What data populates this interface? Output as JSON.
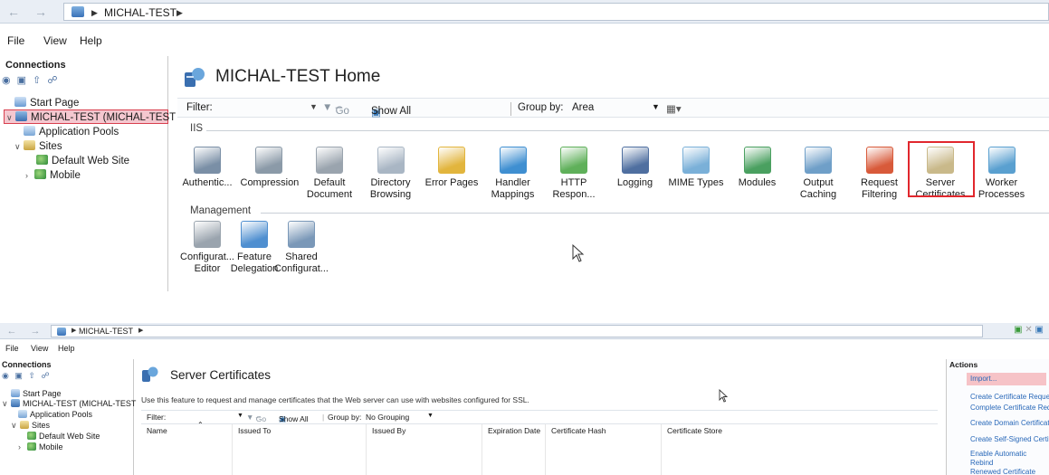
{
  "win1": {
    "address": {
      "crumb": "MICHAL-TEST"
    },
    "menu": [
      "File",
      "View",
      "Help"
    ],
    "connections": {
      "title": "Connections",
      "tree": [
        {
          "label": "Start Page",
          "icon": "start-page-icon"
        },
        {
          "label": "MICHAL-TEST (MICHAL-TEST",
          "icon": "server-icon",
          "selected": true
        },
        {
          "label": "Application Pools",
          "icon": "app-pools-icon"
        },
        {
          "label": "Sites",
          "icon": "sites-folder-icon"
        },
        {
          "label": "Default Web Site",
          "icon": "globe-icon"
        },
        {
          "label": "Mobile",
          "icon": "globe-icon"
        }
      ]
    },
    "home_title": "MICHAL-TEST Home",
    "filter": {
      "label": "Filter:",
      "go": "Go",
      "show_all": "Show All",
      "group_by": "Group by:",
      "group_value": "Area"
    },
    "iis_section": "IIS",
    "iis_features": [
      {
        "label": "Authentic...",
        "icon": "authentication-icon",
        "color": "#7a8fa6"
      },
      {
        "label": "Compression",
        "icon": "compression-icon",
        "color": "#8b9aa8"
      },
      {
        "label": "Default\nDocument",
        "icon": "default-document-icon",
        "color": "#9aa4ae"
      },
      {
        "label": "Directory\nBrowsing",
        "icon": "directory-browsing-icon",
        "color": "#a9b6c4"
      },
      {
        "label": "Error Pages",
        "icon": "error-pages-icon",
        "color": "#e2b53d"
      },
      {
        "label": "Handler\nMappings",
        "icon": "handler-mappings-icon",
        "color": "#3f8fd1"
      },
      {
        "label": "HTTP\nRespon...",
        "icon": "http-response-icon",
        "color": "#5fb05a"
      },
      {
        "label": "Logging",
        "icon": "logging-icon",
        "color": "#4f6fa0"
      },
      {
        "label": "MIME Types",
        "icon": "mime-types-icon",
        "color": "#7ab0d8"
      },
      {
        "label": "Modules",
        "icon": "modules-icon",
        "color": "#4aa060"
      },
      {
        "label": "Output\nCaching",
        "icon": "output-caching-icon",
        "color": "#6f9fc8"
      },
      {
        "label": "Request\nFiltering",
        "icon": "request-filtering-icon",
        "color": "#d85a3a"
      },
      {
        "label": "Server\nCertificates",
        "icon": "server-certificates-icon",
        "color": "#c9b98a",
        "highlighted": true
      },
      {
        "label": "Worker\nProcesses",
        "icon": "worker-processes-icon",
        "color": "#5aa0d0"
      }
    ],
    "management_section": "Management",
    "management_features": [
      {
        "label": "Configurat...\nEditor",
        "icon": "configuration-editor-icon",
        "color": "#9aa4ae"
      },
      {
        "label": "Feature\nDelegation",
        "icon": "feature-delegation-icon",
        "color": "#4f8fd0"
      },
      {
        "label": "Shared\nConfigurat...",
        "icon": "shared-configuration-icon",
        "color": "#7a98b8"
      }
    ],
    "highlight_color": "#e1272d"
  },
  "win2": {
    "address": {
      "crumb": "MICHAL-TEST"
    },
    "menu": [
      "File",
      "View",
      "Help"
    ],
    "connections": {
      "title": "Connections",
      "tree": [
        {
          "label": "Start Page",
          "icon": "start-page-icon"
        },
        {
          "label": "MICHAL-TEST (MICHAL-TEST",
          "icon": "server-icon"
        },
        {
          "label": "Application Pools",
          "icon": "app-pools-icon"
        },
        {
          "label": "Sites",
          "icon": "sites-folder-icon"
        },
        {
          "label": "Default Web Site",
          "icon": "globe-icon"
        },
        {
          "label": "Mobile",
          "icon": "globe-icon"
        }
      ]
    },
    "title": "Server Certificates",
    "description": "Use this feature to request and manage certificates that the Web server can use with websites configured for SSL.",
    "filter": {
      "label": "Filter:",
      "go": "Go",
      "show_all": "Show All",
      "group_by": "Group by:",
      "group_value": "No Grouping"
    },
    "columns": [
      "Name",
      "Issued To",
      "Issued By",
      "Expiration Date",
      "Certificate Hash",
      "Certificate Store"
    ],
    "actions": {
      "title": "Actions",
      "items": [
        "Import...",
        "Create Certificate Request",
        "Complete Certificate Req",
        "Create Domain Certificate",
        "Create Self-Signed Certifi",
        "Enable Automatic Rebind\nRenewed Certificate"
      ],
      "highlight_color": "#f6c3c7"
    }
  }
}
